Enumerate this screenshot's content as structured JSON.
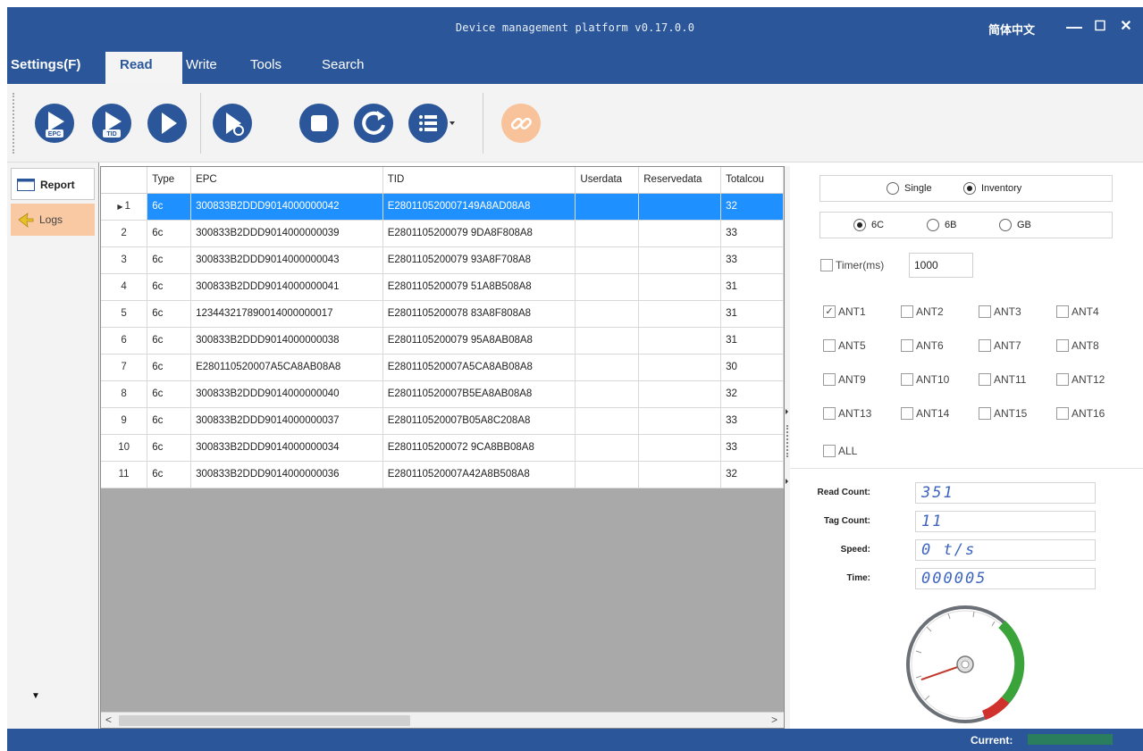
{
  "window": {
    "title": "Device management platform v0.17.0.0",
    "lang_button": "简体中文",
    "minimize_glyph": "—",
    "maximize_glyph": "☐",
    "close_glyph": "✕"
  },
  "menubar": {
    "items": [
      "Settings(F)",
      "Read",
      "Write",
      "Tools",
      "Search"
    ],
    "active": "Read"
  },
  "toolbar": {
    "buttons": [
      {
        "icon": "play-epc-icon",
        "label": "EPC"
      },
      {
        "icon": "play-tid-icon",
        "label": "TID"
      },
      {
        "icon": "play-icon",
        "label": ""
      },
      {
        "icon": "play-user-icon",
        "label": ""
      },
      {
        "icon": "stop-icon",
        "label": ""
      },
      {
        "icon": "refresh-icon",
        "label": ""
      },
      {
        "icon": "list-dropdown-icon",
        "label": ""
      },
      {
        "icon": "link-icon",
        "label": ""
      }
    ]
  },
  "leftnav": {
    "items": [
      {
        "label": "Report",
        "icon": "report-icon",
        "active": true
      },
      {
        "label": "Logs",
        "icon": "logs-icon",
        "active": false
      }
    ],
    "scroll_glyph": "▼"
  },
  "grid": {
    "columns": [
      "",
      "Type",
      "EPC",
      "TID",
      "Userdata",
      "Reservedata",
      "Totalcou"
    ],
    "selected_row": 0,
    "rows": [
      [
        "1",
        "6c",
        "300833B2DDD9014000000042",
        "E280110520007149A8AD08A8",
        "",
        "",
        "32"
      ],
      [
        "2",
        "6c",
        "300833B2DDD9014000000039",
        "E2801105200079 9DA8F808A8",
        "",
        "",
        "33"
      ],
      [
        "3",
        "6c",
        "300833B2DDD9014000000043",
        "E2801105200079 93A8F708A8",
        "",
        "",
        "33"
      ],
      [
        "4",
        "6c",
        "300833B2DDD9014000000041",
        "E2801105200079 51A8B508A8",
        "",
        "",
        "31"
      ],
      [
        "5",
        "6c",
        "123443217890014000000017",
        "E2801105200078 83A8F808A8",
        "",
        "",
        "31"
      ],
      [
        "6",
        "6c",
        "300833B2DDD9014000000038",
        "E2801105200079 95A8AB08A8",
        "",
        "",
        "31"
      ],
      [
        "7",
        "6c",
        "E280110520007A5CA8AB08A8",
        "E280110520007A5CA8AB08A8",
        "",
        "",
        "30"
      ],
      [
        "8",
        "6c",
        "300833B2DDD9014000000040",
        "E280110520007B5EA8AB08A8",
        "",
        "",
        "32"
      ],
      [
        "9",
        "6c",
        "300833B2DDD9014000000037",
        "E280110520007B05A8C208A8",
        "",
        "",
        "33"
      ],
      [
        "10",
        "6c",
        "300833B2DDD9014000000034",
        "E2801105200072 9CA8BB08A8",
        "",
        "",
        "33"
      ],
      [
        "11",
        "6c",
        "300833B2DDD9014000000036",
        "E280110520007A42A8B508A8",
        "",
        "",
        "32"
      ]
    ],
    "scroll_left_glyph": "<",
    "scroll_right_glyph": ">"
  },
  "settings": {
    "mode": {
      "single": "Single",
      "inventory": "Inventory",
      "selected": "inventory"
    },
    "protocol": {
      "options": [
        "6C",
        "6B",
        "GB"
      ],
      "selected": "6C"
    },
    "timer": {
      "label": "Timer(ms)",
      "value": "1000",
      "checked": false
    },
    "antennas": [
      {
        "label": "ANT1",
        "checked": true
      },
      {
        "label": "ANT2",
        "checked": false
      },
      {
        "label": "ANT3",
        "checked": false
      },
      {
        "label": "ANT4",
        "checked": false
      },
      {
        "label": "ANT5",
        "checked": false
      },
      {
        "label": "ANT6",
        "checked": false
      },
      {
        "label": "ANT7",
        "checked": false
      },
      {
        "label": "ANT8",
        "checked": false
      },
      {
        "label": "ANT9",
        "checked": false
      },
      {
        "label": "ANT10",
        "checked": false
      },
      {
        "label": "ANT11",
        "checked": false
      },
      {
        "label": "ANT12",
        "checked": false
      },
      {
        "label": "ANT13",
        "checked": false
      },
      {
        "label": "ANT14",
        "checked": false
      },
      {
        "label": "ANT15",
        "checked": false
      },
      {
        "label": "ANT16",
        "checked": false
      }
    ],
    "all": {
      "label": "ALL",
      "checked": false
    }
  },
  "stats": {
    "read_count_label": "Read Count:",
    "read_count": "351",
    "tag_count_label": "Tag Count:",
    "tag_count": "11",
    "speed_label": "Speed:",
    "speed": "0 t/s",
    "time_label": "Time:",
    "time": "000005"
  },
  "gauge": {
    "needle_fraction": 0.02
  },
  "statusbar": {
    "current_label": "Current:"
  },
  "colors": {
    "accent": "#2b579a",
    "selection": "#1e90ff",
    "gauge_green": "#3aa33a",
    "gauge_red": "#d0312d",
    "link_icon": "#f5b27a"
  }
}
